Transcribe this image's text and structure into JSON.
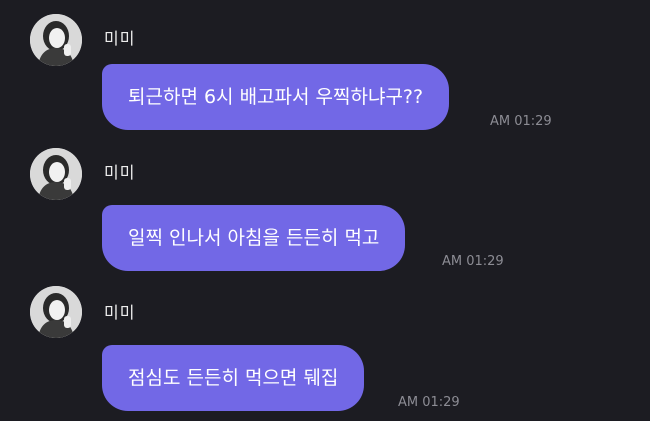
{
  "messages": [
    {
      "sender": "미미",
      "text": "퇴근하면 6시 배고파서 우찍하냐구??",
      "time": "AM 01:29"
    },
    {
      "sender": "미미",
      "text": "일찍 인나서 아침을 든든히 먹고",
      "time": "AM 01:29"
    },
    {
      "sender": "미미",
      "text": "점심도 든든히 먹으면 뒈집",
      "time": "AM 01:29"
    }
  ],
  "colors": {
    "background": "#1c1c22",
    "bubble": "#7268e6",
    "bubble_text": "#ffffff",
    "name_text": "#ececec",
    "time_text": "#8c8c94"
  },
  "icons": {
    "avatar": "profile-photo-avatar"
  }
}
